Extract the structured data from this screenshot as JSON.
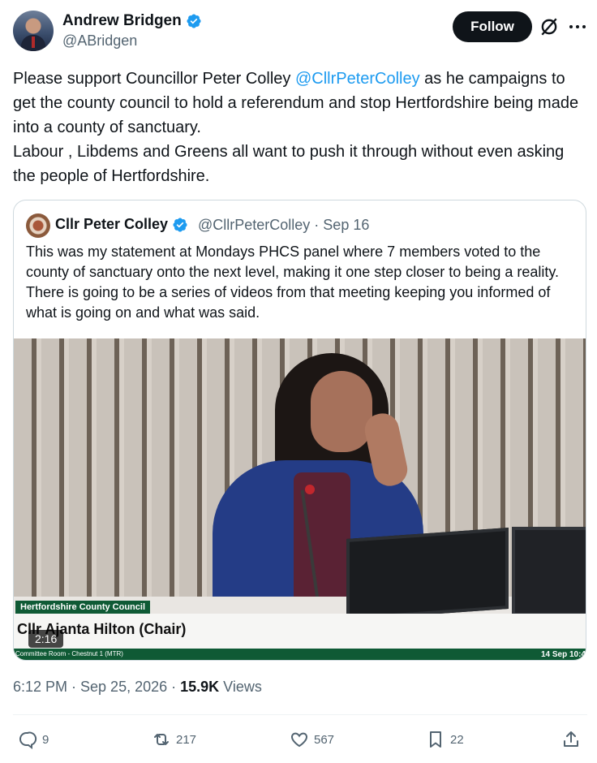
{
  "author": {
    "name": "Andrew Bridgen",
    "handle": "@ABridgen"
  },
  "header": {
    "follow_label": "Follow"
  },
  "tweet": {
    "text_before": "Please support Councillor Peter Colley ",
    "mention": "@CllrPeterColley",
    "text_after": " as he campaigns to get the county council to hold a referendum and stop Hertfordshire being made into a county of sanctuary.",
    "text_line2": "Labour , Libdems and Greens all want to push it through without even asking the people of Hertfordshire."
  },
  "quote": {
    "name": "Cllr Peter Colley",
    "handle_date": "@CllrPeterColley · Sep 16",
    "text": "This was my statement at Mondays PHCS panel where 7 members voted to the county of sanctuary onto the next level, making it one step closer to being a reality. There is going to be a series of videos from that meeting keeping you informed of what is going on and what was said.",
    "video": {
      "org": "Hertfordshire County Council",
      "caption_name": "Cllr Ajanta Hilton (Chair)",
      "room": "Committee Room - Chestnut 1 (MTR)",
      "date": "14 Sep 10:4",
      "duration": "2:16"
    }
  },
  "meta": {
    "time_date": "6:12 PM · Sep 25, 2026 · ",
    "views_count": "15.9K",
    "views_label": " Views"
  },
  "actions": {
    "replies": "9",
    "reposts": "217",
    "likes": "567",
    "bookmarks": "22"
  },
  "colors": {
    "accent": "#1d9bf0",
    "text": "#0f1419",
    "muted": "#536471",
    "council_green": "#0f5a35"
  }
}
